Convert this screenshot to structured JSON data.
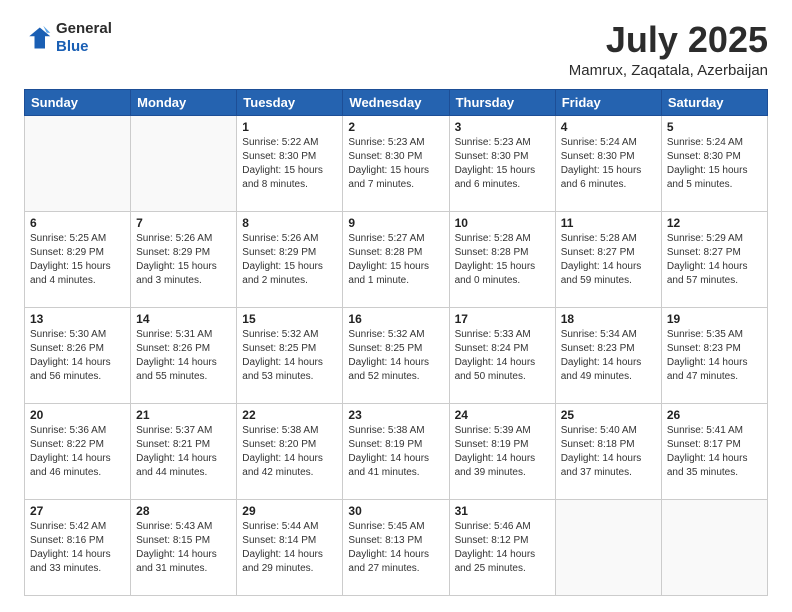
{
  "header": {
    "logo_line1": "General",
    "logo_line2": "Blue",
    "month": "July 2025",
    "location": "Mamrux, Zaqatala, Azerbaijan"
  },
  "weekdays": [
    "Sunday",
    "Monday",
    "Tuesday",
    "Wednesday",
    "Thursday",
    "Friday",
    "Saturday"
  ],
  "weeks": [
    [
      {
        "day": "",
        "text": ""
      },
      {
        "day": "",
        "text": ""
      },
      {
        "day": "1",
        "text": "Sunrise: 5:22 AM\nSunset: 8:30 PM\nDaylight: 15 hours\nand 8 minutes."
      },
      {
        "day": "2",
        "text": "Sunrise: 5:23 AM\nSunset: 8:30 PM\nDaylight: 15 hours\nand 7 minutes."
      },
      {
        "day": "3",
        "text": "Sunrise: 5:23 AM\nSunset: 8:30 PM\nDaylight: 15 hours\nand 6 minutes."
      },
      {
        "day": "4",
        "text": "Sunrise: 5:24 AM\nSunset: 8:30 PM\nDaylight: 15 hours\nand 6 minutes."
      },
      {
        "day": "5",
        "text": "Sunrise: 5:24 AM\nSunset: 8:30 PM\nDaylight: 15 hours\nand 5 minutes."
      }
    ],
    [
      {
        "day": "6",
        "text": "Sunrise: 5:25 AM\nSunset: 8:29 PM\nDaylight: 15 hours\nand 4 minutes."
      },
      {
        "day": "7",
        "text": "Sunrise: 5:26 AM\nSunset: 8:29 PM\nDaylight: 15 hours\nand 3 minutes."
      },
      {
        "day": "8",
        "text": "Sunrise: 5:26 AM\nSunset: 8:29 PM\nDaylight: 15 hours\nand 2 minutes."
      },
      {
        "day": "9",
        "text": "Sunrise: 5:27 AM\nSunset: 8:28 PM\nDaylight: 15 hours\nand 1 minute."
      },
      {
        "day": "10",
        "text": "Sunrise: 5:28 AM\nSunset: 8:28 PM\nDaylight: 15 hours\nand 0 minutes."
      },
      {
        "day": "11",
        "text": "Sunrise: 5:28 AM\nSunset: 8:27 PM\nDaylight: 14 hours\nand 59 minutes."
      },
      {
        "day": "12",
        "text": "Sunrise: 5:29 AM\nSunset: 8:27 PM\nDaylight: 14 hours\nand 57 minutes."
      }
    ],
    [
      {
        "day": "13",
        "text": "Sunrise: 5:30 AM\nSunset: 8:26 PM\nDaylight: 14 hours\nand 56 minutes."
      },
      {
        "day": "14",
        "text": "Sunrise: 5:31 AM\nSunset: 8:26 PM\nDaylight: 14 hours\nand 55 minutes."
      },
      {
        "day": "15",
        "text": "Sunrise: 5:32 AM\nSunset: 8:25 PM\nDaylight: 14 hours\nand 53 minutes."
      },
      {
        "day": "16",
        "text": "Sunrise: 5:32 AM\nSunset: 8:25 PM\nDaylight: 14 hours\nand 52 minutes."
      },
      {
        "day": "17",
        "text": "Sunrise: 5:33 AM\nSunset: 8:24 PM\nDaylight: 14 hours\nand 50 minutes."
      },
      {
        "day": "18",
        "text": "Sunrise: 5:34 AM\nSunset: 8:23 PM\nDaylight: 14 hours\nand 49 minutes."
      },
      {
        "day": "19",
        "text": "Sunrise: 5:35 AM\nSunset: 8:23 PM\nDaylight: 14 hours\nand 47 minutes."
      }
    ],
    [
      {
        "day": "20",
        "text": "Sunrise: 5:36 AM\nSunset: 8:22 PM\nDaylight: 14 hours\nand 46 minutes."
      },
      {
        "day": "21",
        "text": "Sunrise: 5:37 AM\nSunset: 8:21 PM\nDaylight: 14 hours\nand 44 minutes."
      },
      {
        "day": "22",
        "text": "Sunrise: 5:38 AM\nSunset: 8:20 PM\nDaylight: 14 hours\nand 42 minutes."
      },
      {
        "day": "23",
        "text": "Sunrise: 5:38 AM\nSunset: 8:19 PM\nDaylight: 14 hours\nand 41 minutes."
      },
      {
        "day": "24",
        "text": "Sunrise: 5:39 AM\nSunset: 8:19 PM\nDaylight: 14 hours\nand 39 minutes."
      },
      {
        "day": "25",
        "text": "Sunrise: 5:40 AM\nSunset: 8:18 PM\nDaylight: 14 hours\nand 37 minutes."
      },
      {
        "day": "26",
        "text": "Sunrise: 5:41 AM\nSunset: 8:17 PM\nDaylight: 14 hours\nand 35 minutes."
      }
    ],
    [
      {
        "day": "27",
        "text": "Sunrise: 5:42 AM\nSunset: 8:16 PM\nDaylight: 14 hours\nand 33 minutes."
      },
      {
        "day": "28",
        "text": "Sunrise: 5:43 AM\nSunset: 8:15 PM\nDaylight: 14 hours\nand 31 minutes."
      },
      {
        "day": "29",
        "text": "Sunrise: 5:44 AM\nSunset: 8:14 PM\nDaylight: 14 hours\nand 29 minutes."
      },
      {
        "day": "30",
        "text": "Sunrise: 5:45 AM\nSunset: 8:13 PM\nDaylight: 14 hours\nand 27 minutes."
      },
      {
        "day": "31",
        "text": "Sunrise: 5:46 AM\nSunset: 8:12 PM\nDaylight: 14 hours\nand 25 minutes."
      },
      {
        "day": "",
        "text": ""
      },
      {
        "day": "",
        "text": ""
      }
    ]
  ]
}
